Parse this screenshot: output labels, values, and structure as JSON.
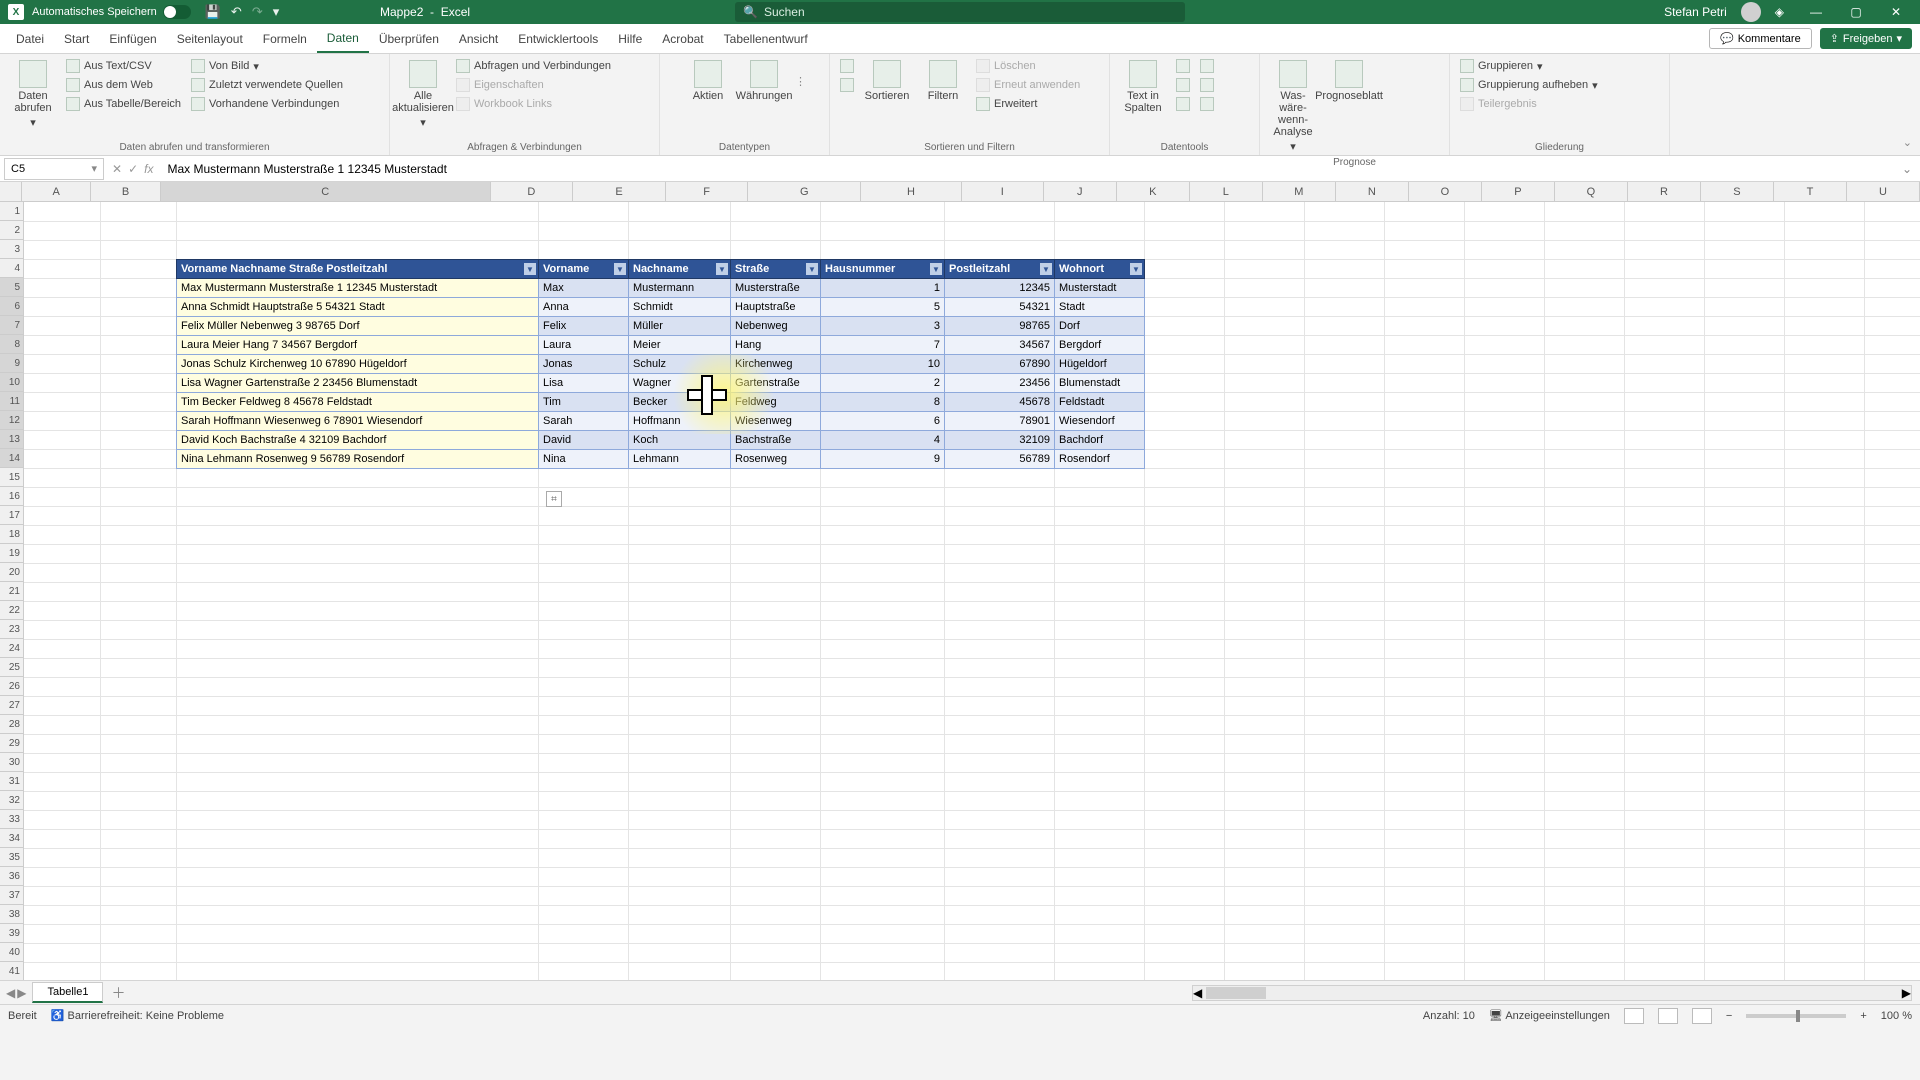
{
  "title": {
    "autosave": "Automatisches Speichern",
    "doc": "Mappe2",
    "app": "Excel",
    "search_placeholder": "Suchen",
    "user": "Stefan Petri"
  },
  "tabs": [
    "Datei",
    "Start",
    "Einfügen",
    "Seitenlayout",
    "Formeln",
    "Daten",
    "Überprüfen",
    "Ansicht",
    "Entwicklertools",
    "Hilfe",
    "Acrobat",
    "Tabellenentwurf"
  ],
  "active_tab": "Daten",
  "comments": "Kommentare",
  "share": "Freigeben",
  "ribbon": {
    "g1": {
      "big": "Daten abrufen",
      "items": [
        "Aus Text/CSV",
        "Aus dem Web",
        "Aus Tabelle/Bereich",
        "Von Bild",
        "Zuletzt verwendete Quellen",
        "Vorhandene Verbindungen"
      ],
      "label": "Daten abrufen und transformieren"
    },
    "g2": {
      "big": "Alle aktualisieren",
      "items": [
        "Abfragen und Verbindungen",
        "Eigenschaften",
        "Workbook Links"
      ],
      "label": "Abfragen & Verbindungen"
    },
    "g3": {
      "items": [
        "Aktien",
        "Währungen"
      ],
      "label": "Datentypen"
    },
    "g4": {
      "items": [
        "Sortieren",
        "Filtern",
        "Löschen",
        "Erneut anwenden",
        "Erweitert"
      ],
      "label": "Sortieren und Filtern"
    },
    "g5": {
      "big": "Text in Spalten",
      "label": "Datentools"
    },
    "g6": {
      "items": [
        "Was-wäre-wenn-Analyse",
        "Prognoseblatt"
      ],
      "label": "Prognose"
    },
    "g7": {
      "items": [
        "Gruppieren",
        "Gruppierung aufheben",
        "Teilergebnis"
      ],
      "label": "Gliederung"
    }
  },
  "namebox": "C5",
  "formula": "Max Mustermann Musterstraße 1 12345 Musterstadt",
  "columns_visible": [
    "A",
    "B",
    "C",
    "D",
    "E",
    "F",
    "G",
    "H",
    "I",
    "J",
    "K",
    "L",
    "M",
    "N",
    "O",
    "P",
    "Q",
    "R",
    "S",
    "T",
    "U"
  ],
  "headers_left": "Vorname Nachname Straße Postleitzahl",
  "headers": {
    "vorname": "Vorname",
    "nachname": "Nachname",
    "strasse": "Straße",
    "hausnummer": "Hausnummer",
    "postleitzahl": "Postleitzahl",
    "wohnort": "Wohnort"
  },
  "rows": [
    {
      "full": "Max Mustermann Musterstraße 1 12345 Musterstadt",
      "vor": "Max",
      "nach": "Mustermann",
      "str": "Musterstraße",
      "hn": "1",
      "plz": "12345",
      "ort": "Musterstadt"
    },
    {
      "full": "Anna Schmidt Hauptstraße 5 54321 Stadt",
      "vor": "Anna",
      "nach": "Schmidt",
      "str": "Hauptstraße",
      "hn": "5",
      "plz": "54321",
      "ort": "Stadt"
    },
    {
      "full": "Felix Müller Nebenweg 3 98765 Dorf",
      "vor": "Felix",
      "nach": "Müller",
      "str": "Nebenweg",
      "hn": "3",
      "plz": "98765",
      "ort": "Dorf"
    },
    {
      "full": "Laura Meier Hang 7 34567 Bergdorf",
      "vor": "Laura",
      "nach": "Meier",
      "str": "Hang",
      "hn": "7",
      "plz": "34567",
      "ort": "Bergdorf"
    },
    {
      "full": "Jonas Schulz Kirchenweg 10 67890 Hügeldorf",
      "vor": "Jonas",
      "nach": "Schulz",
      "str": "Kirchenweg",
      "hn": "10",
      "plz": "67890",
      "ort": "Hügeldorf"
    },
    {
      "full": "Lisa Wagner Gartenstraße 2 23456 Blumenstadt",
      "vor": "Lisa",
      "nach": "Wagner",
      "str": "Gartenstraße",
      "hn": "2",
      "plz": "23456",
      "ort": "Blumenstadt"
    },
    {
      "full": "Tim Becker Feldweg 8 45678 Feldstadt",
      "vor": "Tim",
      "nach": "Becker",
      "str": "Feldweg",
      "hn": "8",
      "plz": "45678",
      "ort": "Feldstadt"
    },
    {
      "full": "Sarah Hoffmann Wiesenweg 6 78901 Wiesendorf",
      "vor": "Sarah",
      "nach": "Hoffmann",
      "str": "Wiesenweg",
      "hn": "6",
      "plz": "78901",
      "ort": "Wiesendorf"
    },
    {
      "full": "David Koch Bachstraße 4 32109 Bachdorf",
      "vor": "David",
      "nach": "Koch",
      "str": "Bachstraße",
      "hn": "4",
      "plz": "32109",
      "ort": "Bachdorf"
    },
    {
      "full": "Nina Lehmann Rosenweg 9 56789 Rosendorf",
      "vor": "Nina",
      "nach": "Lehmann",
      "str": "Rosenweg",
      "hn": "9",
      "plz": "56789",
      "ort": "Rosendorf"
    }
  ],
  "sheet_tab": "Tabelle1",
  "status": {
    "ready": "Bereit",
    "acc": "Barrierefreiheit: Keine Probleme",
    "count_label": "Anzahl:",
    "count": "10",
    "display": "Anzeigeeinstellungen",
    "zoom": "100 %"
  }
}
